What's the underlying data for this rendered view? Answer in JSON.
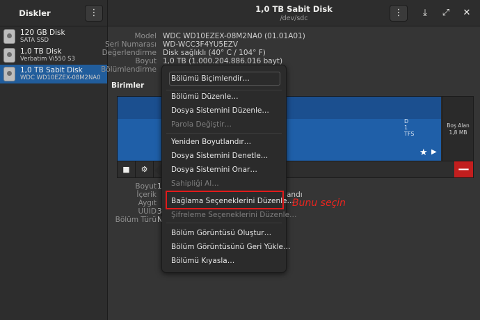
{
  "header": {
    "sidebar_title": "Diskler",
    "title": "1,0 TB Sabit Disk",
    "subtitle": "/dev/sdc",
    "menu_icon": "⋮",
    "eject_icon": "⤓",
    "fullscreen_icon": "⤢",
    "close_icon": "✕"
  },
  "sidebar": {
    "items": [
      {
        "name": "120 GB Disk",
        "sub": "SATA SSD"
      },
      {
        "name": "1,0 TB Disk",
        "sub": "Verbatim Vi550 S3"
      },
      {
        "name": "1,0 TB Sabit Disk",
        "sub": "WDC WD10EZEX-08M2NA0"
      }
    ]
  },
  "details": [
    {
      "label": "Model",
      "value": "WDC WD10EZEX-08M2NA0 (01.01A01)"
    },
    {
      "label": "Seri Numarası",
      "value": "WD-WCC3F4YU5EZV"
    },
    {
      "label": "Değerlendirme",
      "value": "Disk sağlıklı (40° C / 104° F)"
    },
    {
      "label": "Boyut",
      "value": "1,0 TB (1.000.204.886.016 bayt)"
    },
    {
      "label": "Bölümlendirme",
      "value": ""
    }
  ],
  "volumes_title": "Birimler",
  "volume": {
    "part_text_1": "D",
    "part_text_2": "1",
    "part_text_3": "TFS",
    "free_label": "Boş Alan",
    "free_size": "1,8 MB",
    "star_icon": "★",
    "play_icon": "▶",
    "stop_icon": "■",
    "gears_icon": "⚙",
    "minus_icon": "—"
  },
  "part_details": [
    {
      "label": "Boyut",
      "value": "1"
    },
    {
      "label": "İçerik",
      "value": ""
    },
    {
      "label": "Aygıt",
      "value": ""
    },
    {
      "label": "UUID",
      "value": "3"
    },
    {
      "label": "Bölüm Türü",
      "value": "N"
    }
  ],
  "part_details_partial": "andı",
  "menu": {
    "items": [
      "Bölümü Biçimlendir…",
      "Bölümü Düzenle…",
      "Dosya Sistemini Düzenle…",
      "Parola Değiştir…",
      "Yeniden Boyutlandır…",
      "Dosya Sistemini Denetle…",
      "Dosya Sistemini Onar…",
      "Sahipliği Al…",
      "Bağlama Seçeneklerini Düzenle…",
      "Şifreleme Seçeneklerini Düzenle…",
      "Bölüm Görüntüsü Oluştur…",
      "Bölüm Görüntüsünü Geri Yükle…",
      "Bölümü Kıyasla…"
    ]
  },
  "annotation": "Bunu seçin",
  "colors": {
    "accent": "#215d9c",
    "partition": "#1f5fa8",
    "highlight": "#e21a1a"
  }
}
